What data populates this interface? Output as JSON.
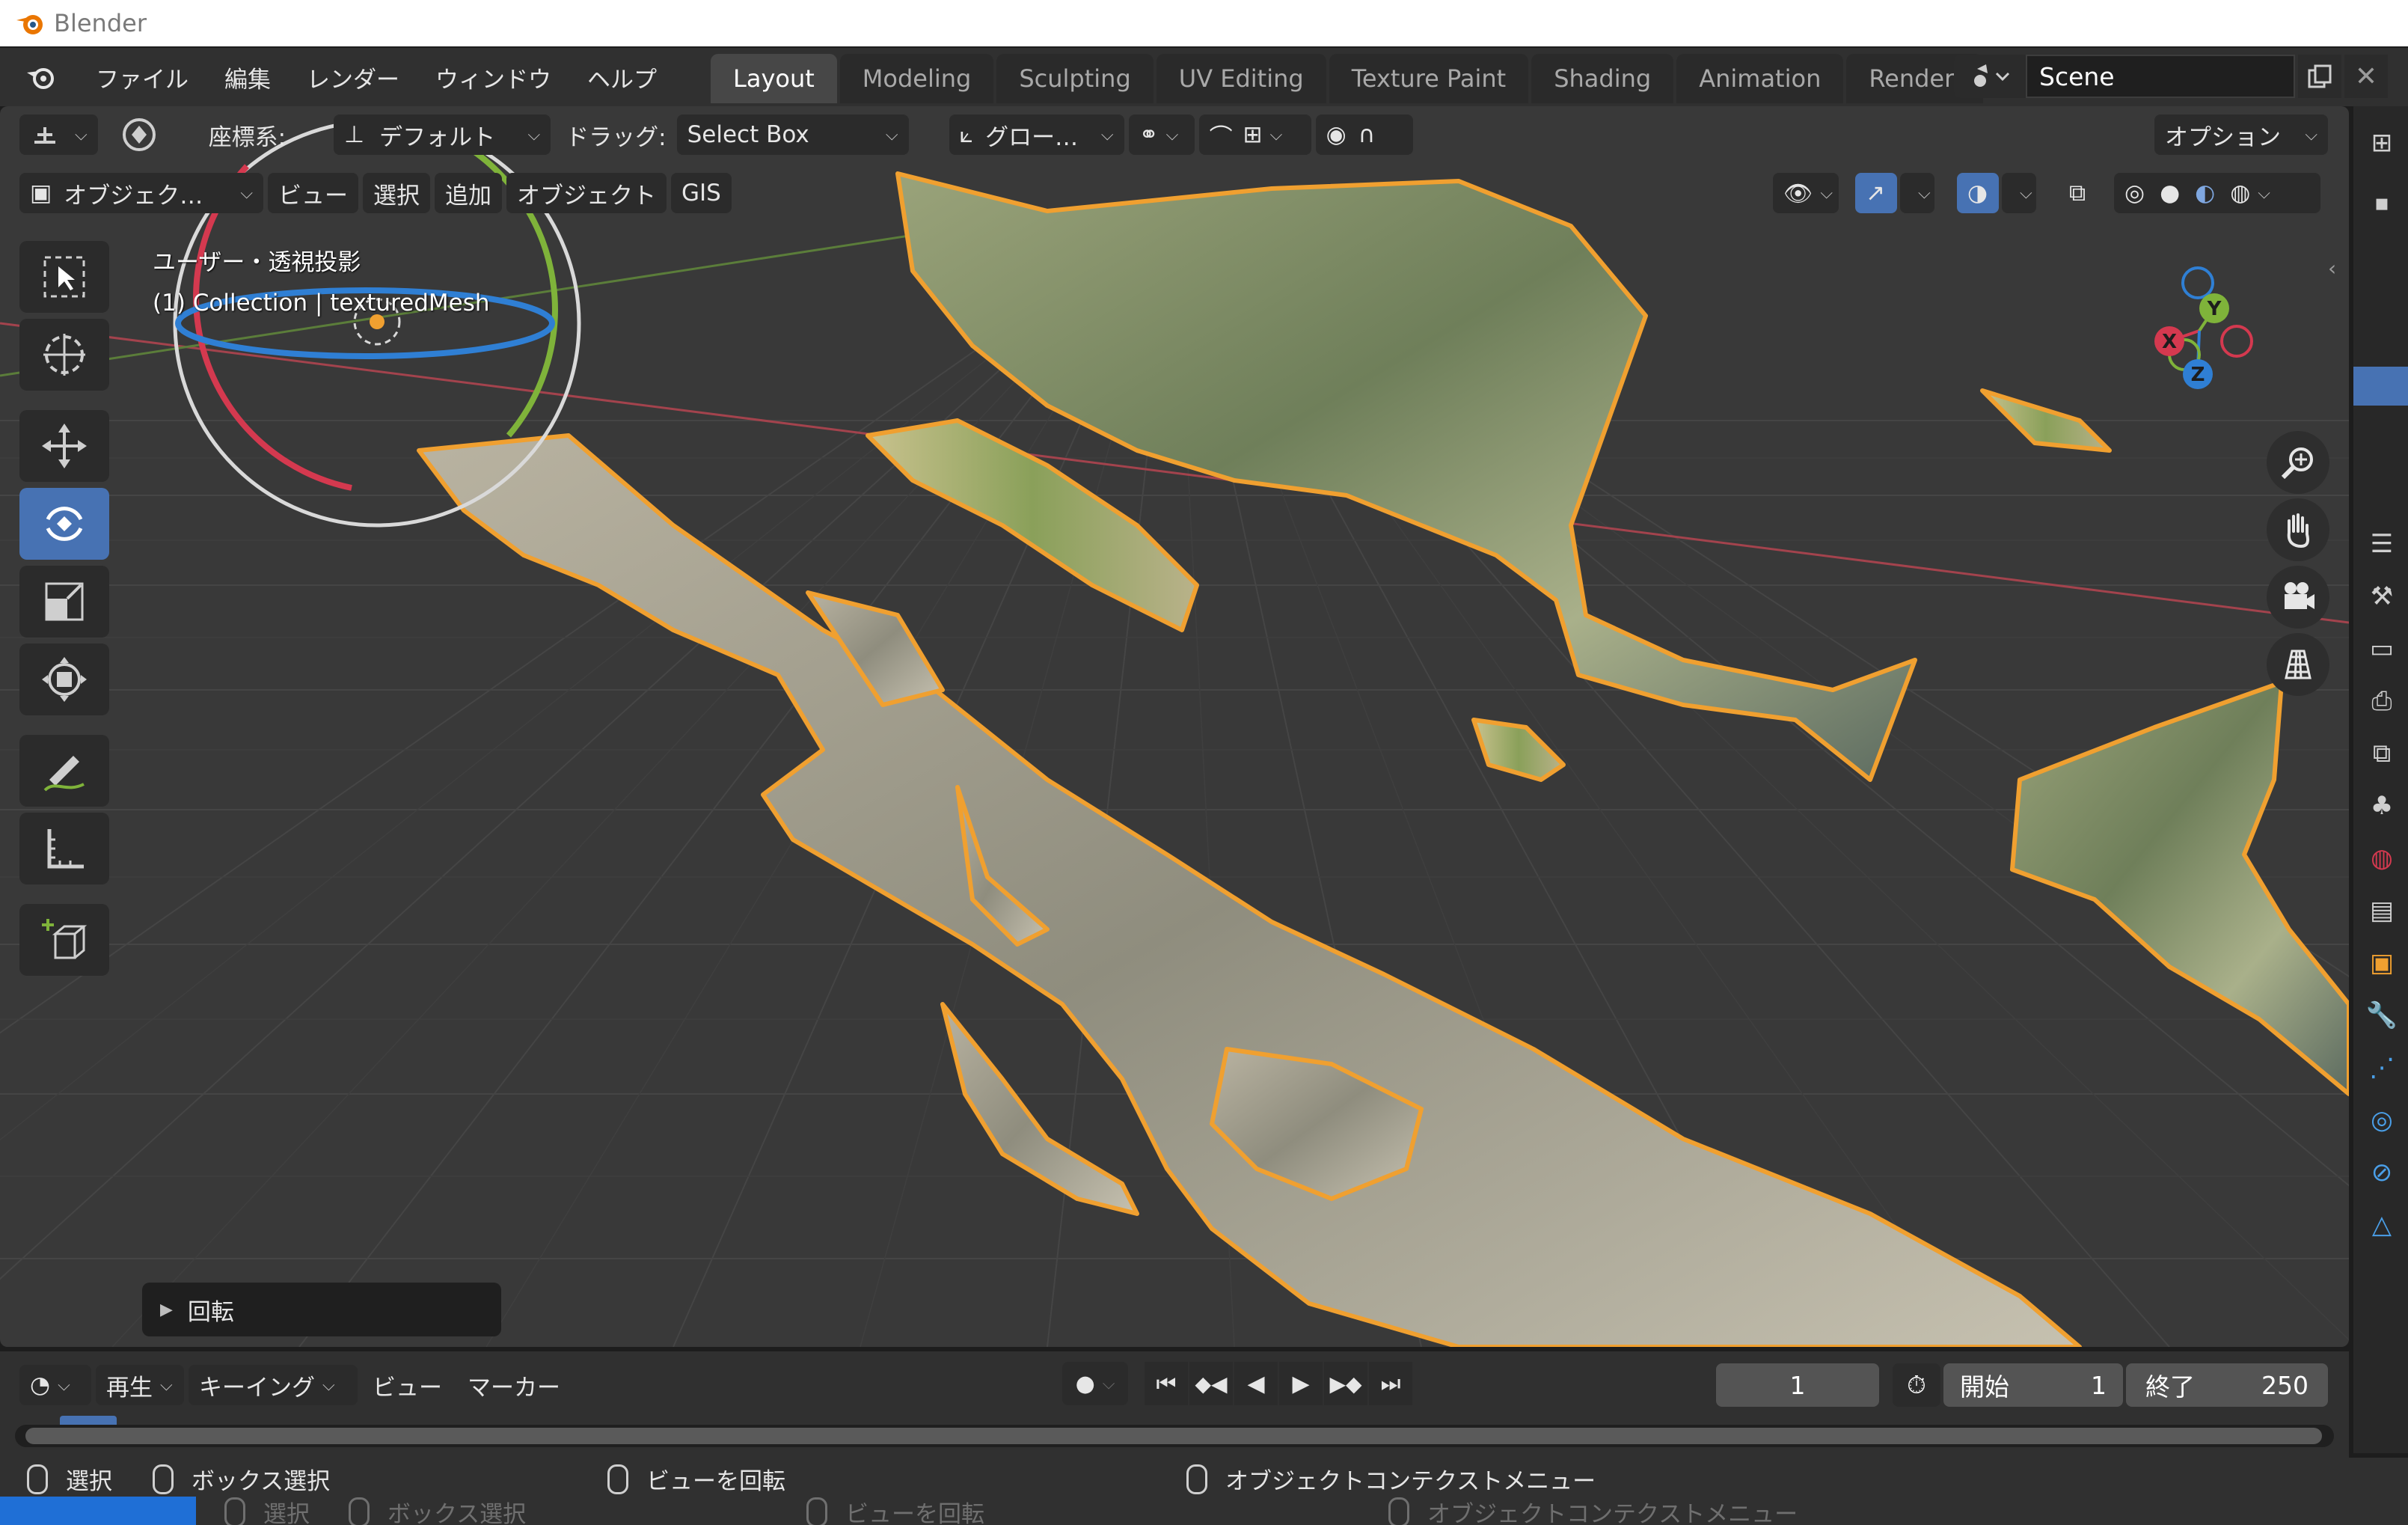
{
  "os": {
    "app_title": "Blender"
  },
  "menu": {
    "items": [
      "ファイル",
      "編集",
      "レンダー",
      "ウィンドウ",
      "ヘルプ"
    ]
  },
  "workspaces": {
    "tabs": [
      "Layout",
      "Modeling",
      "Sculpting",
      "UV Editing",
      "Texture Paint",
      "Shading",
      "Animation",
      "Renderi"
    ],
    "active": "Layout"
  },
  "scene": {
    "name": "Scene"
  },
  "header1": {
    "coord_label": "座標系:",
    "coord_value": "デフォルト",
    "drag_label": "ドラッグ:",
    "drag_value": "Select Box",
    "pivot_value": "グロー…",
    "options_label": "オプション"
  },
  "header2": {
    "mode": "オブジェク…",
    "view": "ビュー",
    "select": "選択",
    "add": "追加",
    "object": "オブジェクト",
    "gis": "GIS"
  },
  "viewport_info": {
    "line1": "ユーザー・透視投影",
    "line2": "(1) Collection | texturedMesh"
  },
  "gizmo": {
    "x": "X",
    "y": "Y",
    "z": "Z"
  },
  "operator_panel": {
    "label": "回転"
  },
  "timeline": {
    "playback": "再生",
    "keying": "キーイング",
    "view": "ビュー",
    "marker": "マーカー",
    "current_frame": "1",
    "start_label": "開始",
    "start_value": "1",
    "end_label": "終了",
    "end_value": "250"
  },
  "statusbar": {
    "select": "選択",
    "box_select": "ボックス選択",
    "rotate_view": "ビューを回転",
    "context_menu": "オブジェクトコンテクストメニュー"
  },
  "colors": {
    "accent": "#4772b3",
    "selection_outline": "#f0a030",
    "axis_x": "#d4394f",
    "axis_y": "#7fb33a",
    "axis_z": "#2f7fd4"
  },
  "icons": [
    "blender-icon",
    "transform-icon",
    "select-box-icon",
    "cursor-icon",
    "move-icon",
    "rotate-icon",
    "scale-icon",
    "transform-tool-icon",
    "annotate-icon",
    "measure-icon",
    "add-cube-icon",
    "zoom-icon",
    "hand-icon",
    "camera-icon",
    "grid-icon"
  ]
}
